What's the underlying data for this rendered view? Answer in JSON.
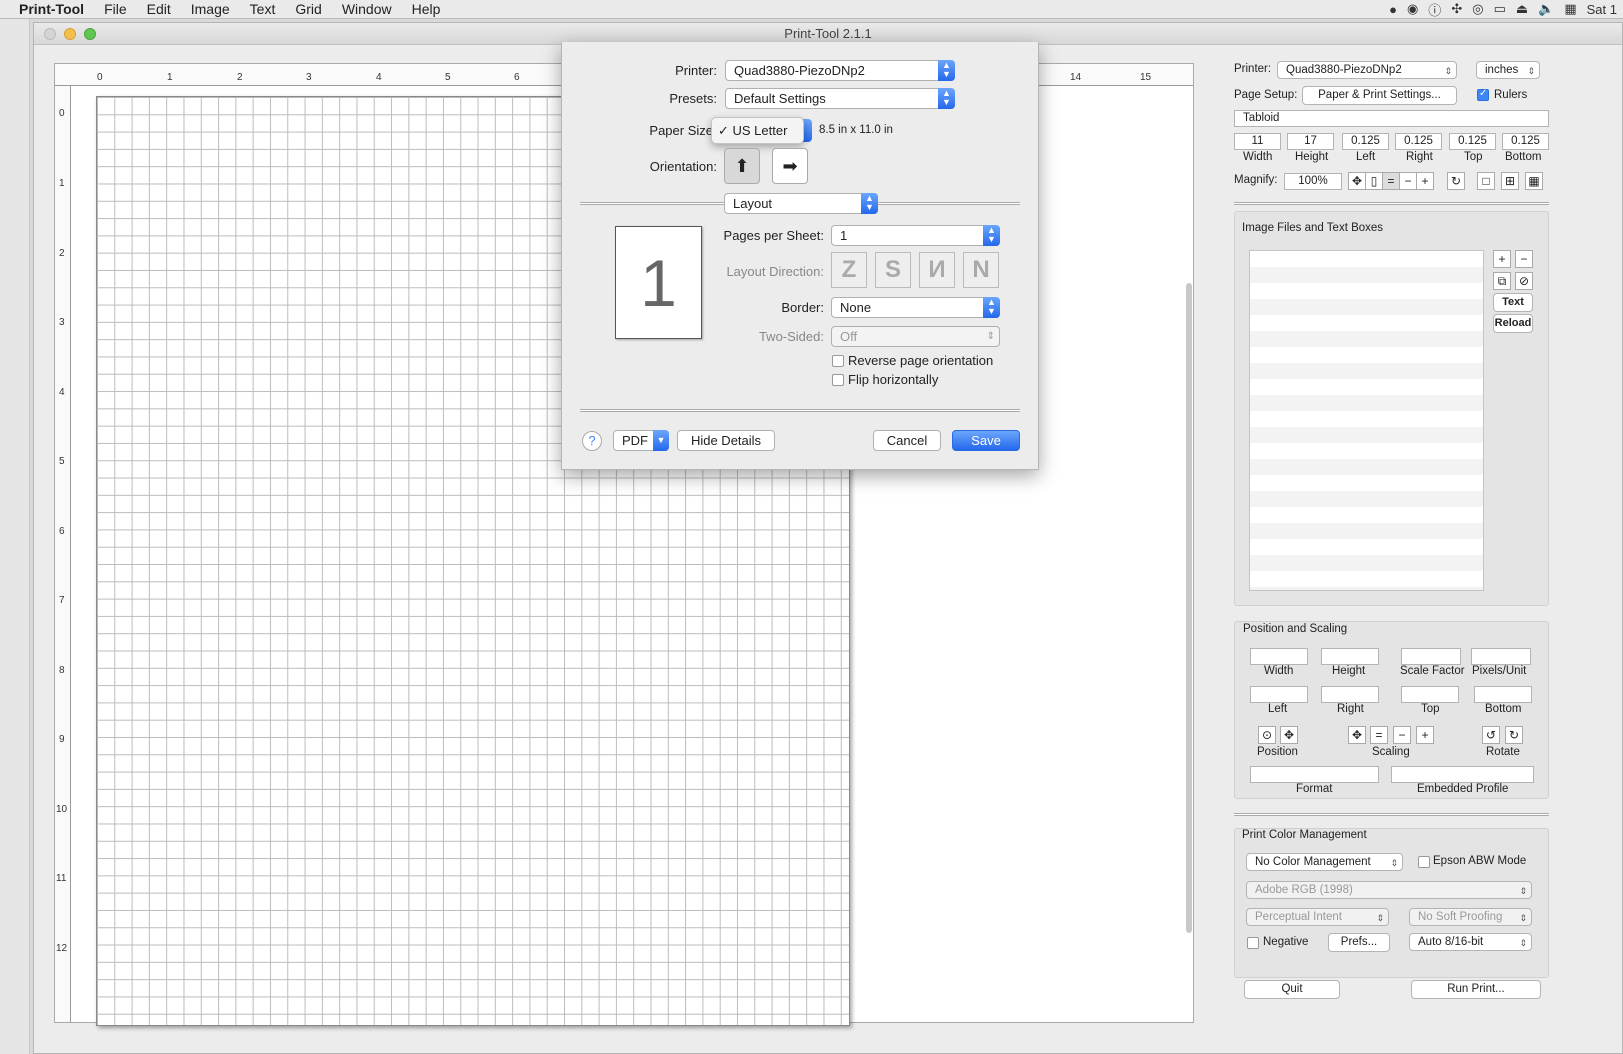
{
  "menubar": {
    "app": "Print-Tool",
    "items": [
      "File",
      "Edit",
      "Image",
      "Text",
      "Grid",
      "Window",
      "Help"
    ],
    "clock": "Sat 1"
  },
  "window": {
    "title": "Print-Tool 2.1.1"
  },
  "ruler": {
    "h_ticks": [
      "0",
      "1",
      "2",
      "3",
      "4",
      "5",
      "6",
      "14",
      "15"
    ],
    "v_ticks": [
      "0",
      "1",
      "2",
      "3",
      "4",
      "5",
      "6",
      "7",
      "8",
      "9",
      "10",
      "11",
      "12"
    ]
  },
  "sidebar": {
    "printer_label": "Printer:",
    "printer_value": "Quad3880-PiezoDNp2",
    "units": "inches",
    "page_setup_label": "Page Setup:",
    "page_setup_button": "Paper & Print Settings...",
    "rulers_label": "Rulers",
    "paper_name": "Tabloid",
    "dims": [
      {
        "value": "11",
        "label": "Width"
      },
      {
        "value": "17",
        "label": "Height"
      },
      {
        "value": "0.125",
        "label": "Left"
      },
      {
        "value": "0.125",
        "label": "Right"
      },
      {
        "value": "0.125",
        "label": "Top"
      },
      {
        "value": "0.125",
        "label": "Bottom"
      }
    ],
    "magnify_label": "Magnify:",
    "magnify_value": "100%",
    "images_title": "Image Files and Text Boxes",
    "text_button": "Text",
    "reload_button": "Reload",
    "pos_title": "Position and Scaling",
    "pos_labels_row1": [
      "Width",
      "Height",
      "Scale Factor",
      "Pixels/Unit"
    ],
    "pos_labels_row2": [
      "Left",
      "Right",
      "Top",
      "Bottom"
    ],
    "position_label": "Position",
    "scaling_label": "Scaling",
    "rotate_label": "Rotate",
    "format_label": "Format",
    "embedded_label": "Embedded Profile",
    "pcm_title": "Print Color Management",
    "color_mgmt": "No Color Management",
    "epson_abw": "Epson ABW Mode",
    "profile": "Adobe RGB (1998)",
    "intent": "Perceptual Intent",
    "soft_proof": "No Soft Proofing",
    "negative": "Negative",
    "prefs_button": "Prefs...",
    "bit_depth": "Auto 8/16-bit",
    "quit_button": "Quit",
    "run_button": "Run Print..."
  },
  "dialog": {
    "printer_label": "Printer:",
    "printer_value": "Quad3880-PiezoDNp2",
    "presets_label": "Presets:",
    "presets_value": "Default Settings",
    "paper_label": "Paper Size",
    "paper_value": "✓ US Letter",
    "paper_dims": "8.5 in x 11.0 in",
    "orientation_label": "Orientation:",
    "section": "Layout",
    "preview_number": "1",
    "pages_label": "Pages per Sheet:",
    "pages_value": "1",
    "direction_label": "Layout Direction:",
    "border_label": "Border:",
    "border_value": "None",
    "twosided_label": "Two-Sided:",
    "twosided_value": "Off",
    "reverse_label": "Reverse page orientation",
    "flip_label": "Flip horizontally",
    "help": "?",
    "pdf_button": "PDF",
    "hide_details": "Hide Details",
    "cancel": "Cancel",
    "save": "Save"
  },
  "colors": {
    "accent": "#3c86f5"
  }
}
